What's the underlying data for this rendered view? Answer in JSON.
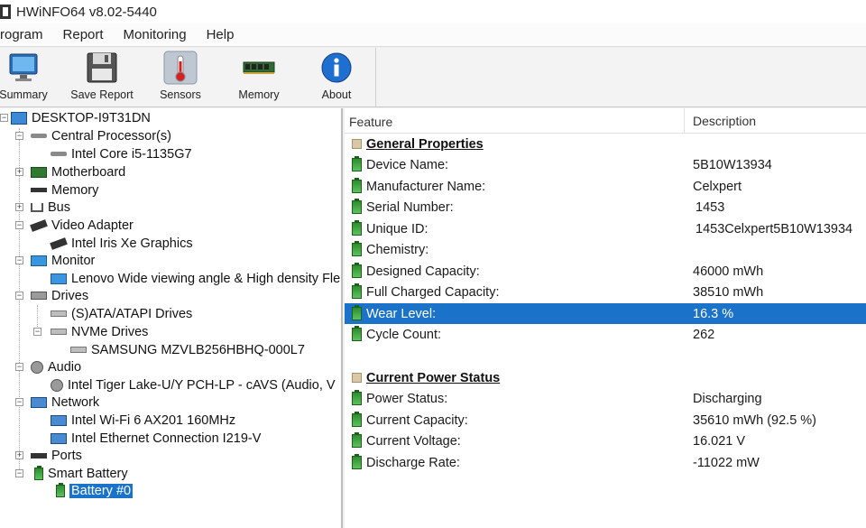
{
  "window": {
    "title": "HWiNFO64 v8.02-5440"
  },
  "menu": [
    "rogram",
    "Report",
    "Monitoring",
    "Help"
  ],
  "toolbar": {
    "summary": "Summary",
    "save_report": "Save Report",
    "sensors": "Sensors",
    "memory": "Memory",
    "about": "About"
  },
  "tree": {
    "root": "DESKTOP-I9T31DN",
    "cpu": "Central Processor(s)",
    "cpu_item": "Intel Core i5-1135G7",
    "motherboard": "Motherboard",
    "memory": "Memory",
    "bus": "Bus",
    "video": "Video Adapter",
    "video_item": "Intel Iris Xe Graphics",
    "monitor": "Monitor",
    "monitor_item": "Lenovo Wide viewing angle & High density Fle",
    "drives": "Drives",
    "sata": "(S)ATA/ATAPI Drives",
    "nvme": "NVMe Drives",
    "nvme_item": "SAMSUNG MZVLB256HBHQ-000L7",
    "audio": "Audio",
    "audio_item": "Intel Tiger Lake-U/Y PCH-LP - cAVS (Audio, V",
    "network": "Network",
    "net_wifi": "Intel Wi-Fi 6 AX201 160MHz",
    "net_eth": "Intel Ethernet Connection I219-V",
    "ports": "Ports",
    "battery": "Smart Battery",
    "battery_item": "Battery #0"
  },
  "detail": {
    "col_feature": "Feature",
    "col_description": "Description",
    "general_title": "General Properties",
    "general": [
      {
        "feature": "Device Name:",
        "value": "5B10W13934"
      },
      {
        "feature": "Manufacturer Name:",
        "value": "Celxpert"
      },
      {
        "feature": "Serial Number:",
        "value": "1453"
      },
      {
        "feature": "Unique ID:",
        "value": "1453Celxpert5B10W13934"
      },
      {
        "feature": "Chemistry:",
        "value": ""
      },
      {
        "feature": "Designed Capacity:",
        "value": "46000 mWh"
      },
      {
        "feature": "Full Charged Capacity:",
        "value": "38510 mWh"
      },
      {
        "feature": "Wear Level:",
        "value": "16.3 %"
      },
      {
        "feature": "Cycle Count:",
        "value": "262"
      }
    ],
    "power_title": "Current Power Status",
    "power": [
      {
        "feature": "Power Status:",
        "value": "Discharging"
      },
      {
        "feature": "Current Capacity:",
        "value": "35610 mWh (92.5 %)"
      },
      {
        "feature": "Current Voltage:",
        "value": "16.021 V"
      },
      {
        "feature": "Discharge Rate:",
        "value": "-11022 mW"
      }
    ]
  },
  "colors": {
    "selection": "#1a73c8",
    "battery_green": "#2e8b2e"
  }
}
